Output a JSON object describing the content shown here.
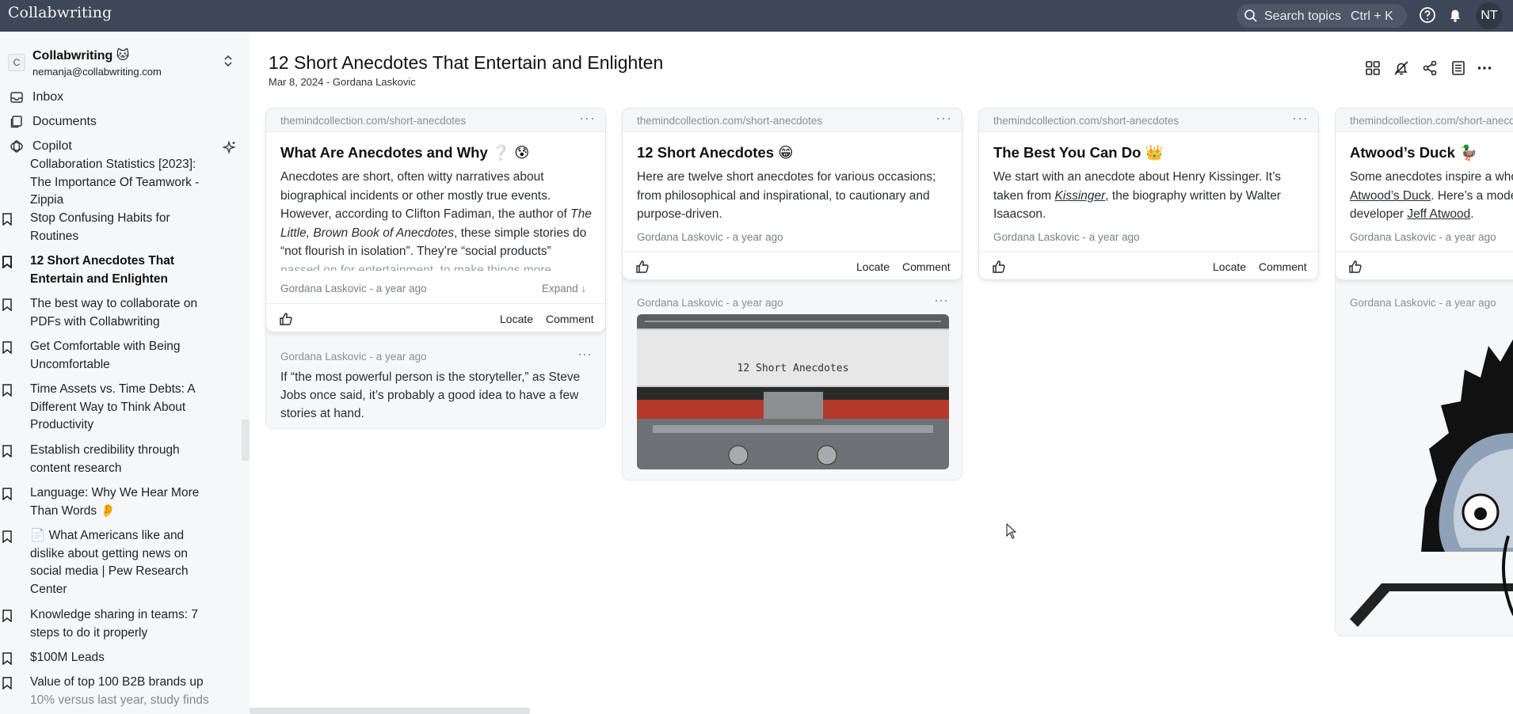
{
  "app": {
    "title": "Collabwriting"
  },
  "search": {
    "placeholder": "Search topics",
    "shortcut": "Ctrl + K"
  },
  "user": {
    "initials": "NT"
  },
  "workspace": {
    "name": "Collabwriting 🐱",
    "badge": "C",
    "email": "nemanja@collabwriting.com"
  },
  "nav": [
    {
      "label": "Inbox",
      "icon": "inbox-icon"
    },
    {
      "label": "Documents",
      "icon": "documents-icon"
    },
    {
      "label": "Copilot",
      "icon": "copilot-icon"
    }
  ],
  "docs": [
    {
      "lines": [
        "Collaboration Statistics [2023]:",
        "The Importance Of Teamwork -",
        "Zippia"
      ],
      "active": false
    },
    {
      "lines": [
        "Stop Confusing Habits for",
        "Routines"
      ],
      "active": false
    },
    {
      "lines": [
        "12 Short Anecdotes That",
        "Entertain and Enlighten"
      ],
      "active": true
    },
    {
      "lines": [
        "The best way to collaborate on",
        "PDFs with Collabwriting"
      ],
      "active": false
    },
    {
      "lines": [
        "Get Comfortable with Being",
        "Uncomfortable"
      ],
      "active": false
    },
    {
      "lines": [
        "Time Assets vs. Time Debts: A",
        "Different Way to Think About",
        "Productivity"
      ],
      "active": false
    },
    {
      "lines": [
        "Establish credibility through",
        "content research"
      ],
      "active": false
    },
    {
      "lines": [
        "Language: Why We Hear More",
        "Than Words 👂"
      ],
      "active": false
    },
    {
      "lines": [
        "📄 What Americans like and",
        "dislike about getting news on",
        "social media | Pew Research",
        "Center"
      ],
      "active": false
    },
    {
      "lines": [
        "Knowledge sharing in teams: 7",
        "steps to do it properly"
      ],
      "active": false
    },
    {
      "lines": [
        "$100M Leads"
      ],
      "active": false
    },
    {
      "lines": [
        "Value of top 100 B2B brands up",
        "10% versus last year, study finds"
      ],
      "active": false
    }
  ],
  "page": {
    "title": "12 Short Anecdotes That Entertain and Enlighten",
    "meta": "Mar 8, 2024 - Gordana Laskovic"
  },
  "cards": [
    {
      "source": "themindcollection.com/short-anecdotes",
      "title": "What Are Anecdotes and Why ❔ 😰",
      "body_html": "Anecdotes are short, often witty narratives about biographical incidents or other mostly true events. However, according to Clifton Fadiman, the author of <i>The Little, Brown Book of Anecdotes</i>, these simple stories do “not flourish in isolation”. They’re “social products” <span class=\"fade\">passed on for entertainment, to make things more</span>",
      "author": "Gordana Laskovic - a year ago",
      "expand": "Expand ↓",
      "locate": "Locate",
      "comment": "Comment"
    },
    {
      "source": "themindcollection.com/short-anecdotes",
      "title": "12 Short Anecdotes 😁",
      "body_html": "Here are twelve short anecdotes for various occasions; from philosophical and inspirational, to cautionary and purpose-driven.",
      "author": "Gordana Laskovic - a year ago",
      "locate": "Locate",
      "comment": "Comment"
    },
    {
      "source": "themindcollection.com/short-anecdotes",
      "title": "The Best You Can Do 👑",
      "body_html": "We start with an anecdote about Henry Kissinger. It’s taken from <i><u>Kissinger</u></i>, the biography written by Walter Isaacson.",
      "author": "Gordana Laskovic - a year ago",
      "locate": "Locate",
      "comment": "Comment"
    },
    {
      "source": "themindcollection.com/short-anecdotes",
      "title": "Atwood’s Duck 🦆",
      "body_html": "Some anecdotes inspire a whole <u>Atwood’s Duck</u>. Here’s a modern developer <u>Jeff Atwood</u>.",
      "author": "Gordana Laskovic - a year ago"
    }
  ],
  "subs": [
    {
      "meta": "Gordana Laskovic  -  a year ago",
      "quote": "If “the most powerful person is the storyteller,” as Steve Jobs once said, it’s probably a good idea to have a few stories at hand."
    },
    {
      "meta": "Gordana Laskovic  -  a year ago",
      "image_caption": "12 Short Anecdotes"
    },
    {
      "meta": "Gordana Laskovic  -  a year ago"
    }
  ],
  "colors": {
    "topbar": "#3d4757",
    "sidebar": "#f6f7f8",
    "typewriter_red": "#b43a2c"
  }
}
